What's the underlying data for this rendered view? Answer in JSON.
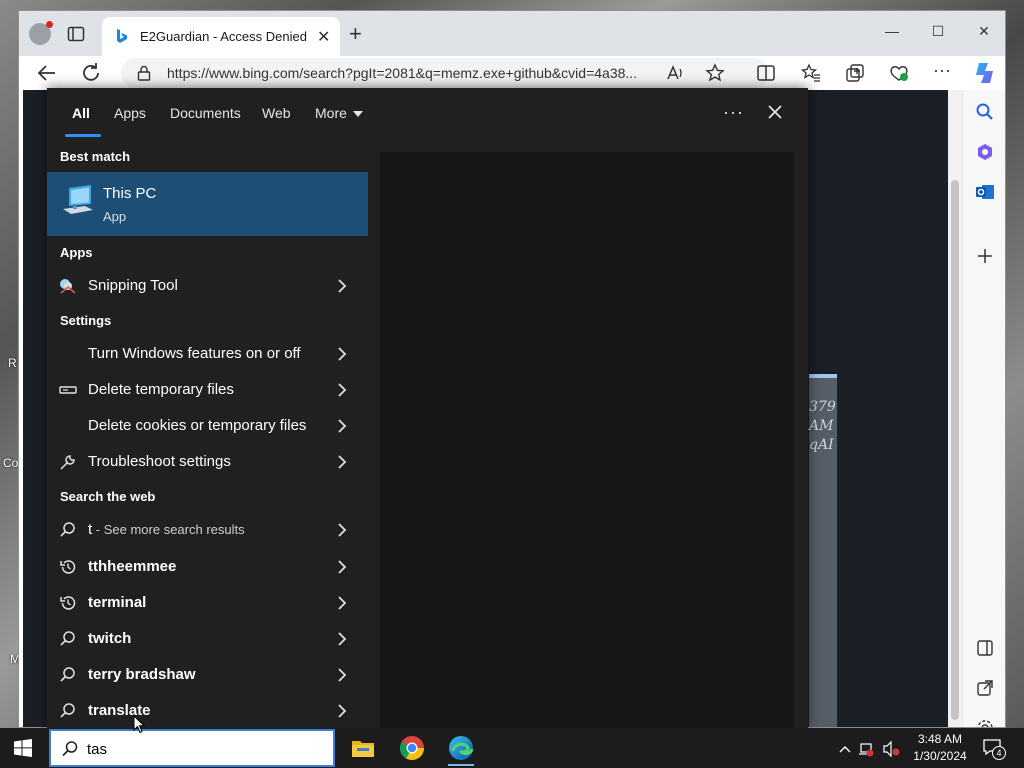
{
  "desktop": {
    "fragments": [
      "R",
      "Co",
      "M"
    ]
  },
  "browser": {
    "tab": {
      "title": "E2Guardian - Access Denied",
      "close": "✕"
    },
    "new_tab": "+",
    "window_controls": {
      "minimize": "—",
      "maximize": "☐",
      "close": "✕"
    },
    "url": "https://www.bing.com/search?pgIt=2081&q=memz.exe+github&cvid=4a38...",
    "page_fragments": [
      "379",
      "AM",
      "qAI"
    ]
  },
  "search_panel": {
    "tabs": [
      "All",
      "Apps",
      "Documents",
      "Web",
      "More"
    ],
    "active_tab": "All",
    "ellipsis": "···",
    "best_match": {
      "heading": "Best match",
      "name": "This PC",
      "type": "App"
    },
    "apps": {
      "heading": "Apps",
      "items": [
        {
          "label": "Snipping Tool"
        }
      ]
    },
    "settings": {
      "heading": "Settings",
      "items": [
        {
          "label": "Turn Windows features on or off"
        },
        {
          "label": "Delete temporary files"
        },
        {
          "label": "Delete cookies or temporary files"
        },
        {
          "label": "Troubleshoot settings"
        }
      ]
    },
    "web": {
      "heading": "Search the web",
      "first": {
        "label": "t",
        "sub": " - See more search results"
      },
      "items": [
        {
          "label": "tthheemmee",
          "icon": "history-icon"
        },
        {
          "label": "terminal",
          "icon": "history-icon"
        },
        {
          "label": "twitch",
          "icon": "search-icon"
        },
        {
          "label": "terry bradshaw",
          "icon": "search-icon"
        },
        {
          "label": "translate",
          "icon": "search-icon"
        }
      ]
    }
  },
  "taskbar": {
    "search_value": "tas",
    "clock_time": "3:48 AM",
    "clock_date": "1/30/2024",
    "notification_count": "4"
  },
  "colors": {
    "accent": "#2f8ef4",
    "best_match_bg": "#1d4e76",
    "panel_bg": "#202020",
    "taskbar_bg": "#1c1c1c"
  }
}
